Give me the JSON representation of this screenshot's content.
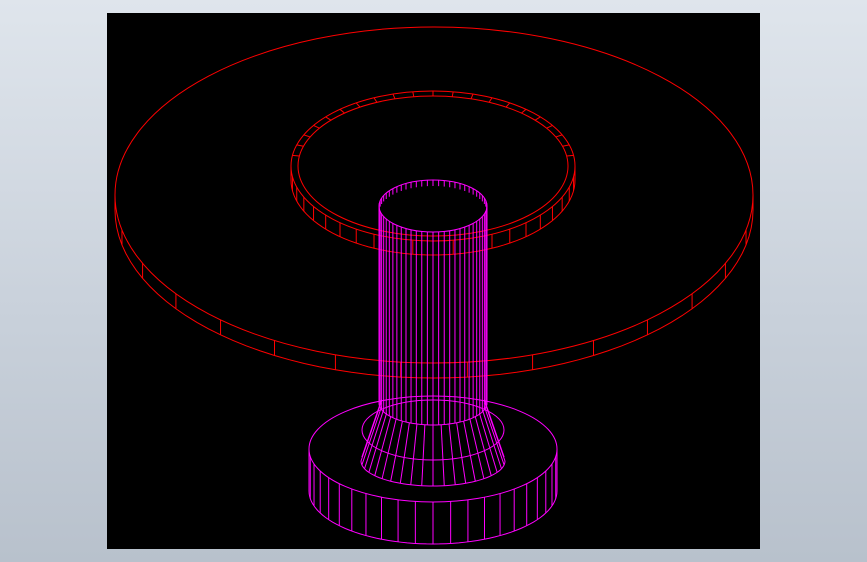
{
  "model": {
    "colors": {
      "background": "#000000",
      "ring_edges": "#ff0000",
      "shaft_edges": "#ff00ff"
    },
    "parts": [
      {
        "name": "outer-ring-disc",
        "color": "#ff0000"
      },
      {
        "name": "inner-ring-disc",
        "color": "#ff0000"
      },
      {
        "name": "shaft-cylinder",
        "color": "#ff00ff"
      },
      {
        "name": "conical-fillet",
        "color": "#ff00ff"
      },
      {
        "name": "base-flange",
        "color": "#ff00ff"
      }
    ]
  }
}
